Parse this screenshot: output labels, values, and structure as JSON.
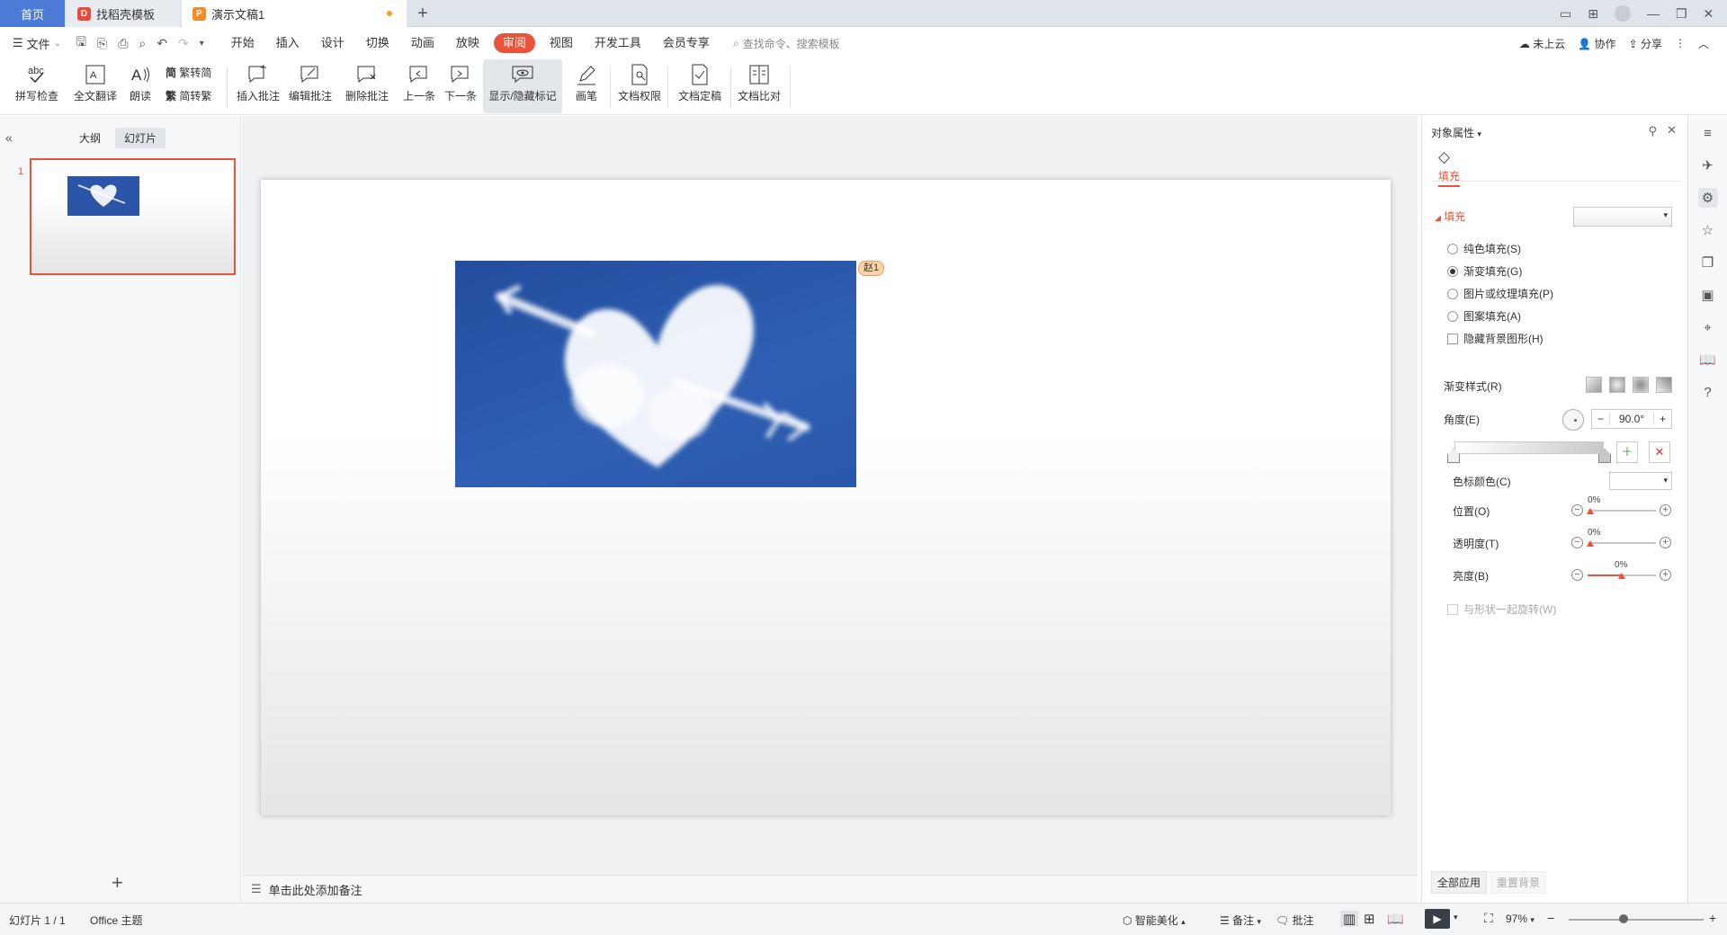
{
  "tabs": {
    "home": "首页",
    "templates": "找稻壳模板",
    "doc": "演示文稿1"
  },
  "menu": {
    "file": "文件",
    "items": [
      "开始",
      "插入",
      "设计",
      "切换",
      "动画",
      "放映",
      "审阅",
      "视图",
      "开发工具",
      "会员专享"
    ],
    "active": "审阅",
    "search": "查找命令、搜索模板",
    "cloud": "未上云",
    "collab": "协作",
    "share": "分享"
  },
  "ribbon": {
    "spell": "拼写检查",
    "translate": "全文翻译",
    "read": "朗读",
    "t2s": "繁转简",
    "s2t": "简转繁",
    "insert_comment": "插入批注",
    "edit_comment": "编辑批注",
    "delete_comment": "删除批注",
    "prev": "上一条",
    "next": "下一条",
    "toggle_marks": "显示/隐藏标记",
    "pen": "画笔",
    "permission": "文档权限",
    "finalize": "文档定稿",
    "compare": "文档比对"
  },
  "leftpane": {
    "outline": "大纲",
    "slides": "幻灯片",
    "slide_number": "1"
  },
  "slide": {
    "comment_tag": "赵1"
  },
  "notes": {
    "placeholder": "单击此处添加备注"
  },
  "panel": {
    "title": "对象属性",
    "tab_fill": "填充",
    "section_fill": "填充",
    "options": [
      "纯色填充(S)",
      "渐变填充(G)",
      "图片或纹理填充(P)",
      "图案填充(A)"
    ],
    "selected_option": "渐变填充(G)",
    "hide_bg": "隐藏背景图形(H)",
    "gradient_style": "渐变样式(R)",
    "angle_label": "角度(E)",
    "angle_value": "90.0°",
    "stop_color": "色标颜色(C)",
    "position": "位置(O)",
    "transparency": "透明度(T)",
    "brightness": "亮度(B)",
    "position_value": "0%",
    "transparency_value": "0%",
    "brightness_value": "0%",
    "rotate_with_shape": "与形状一起旋转(W)",
    "apply_all": "全部应用",
    "reset_bg": "重置背景"
  },
  "status": {
    "slide_info": "幻灯片 1 / 1",
    "theme": "Office 主题",
    "beautify": "智能美化",
    "notes": "备注",
    "comments": "批注",
    "zoom": "97%"
  },
  "colors": {
    "accent": "#e8533a",
    "tab_home": "#4c7bd7",
    "sky": "#2a55a8"
  }
}
